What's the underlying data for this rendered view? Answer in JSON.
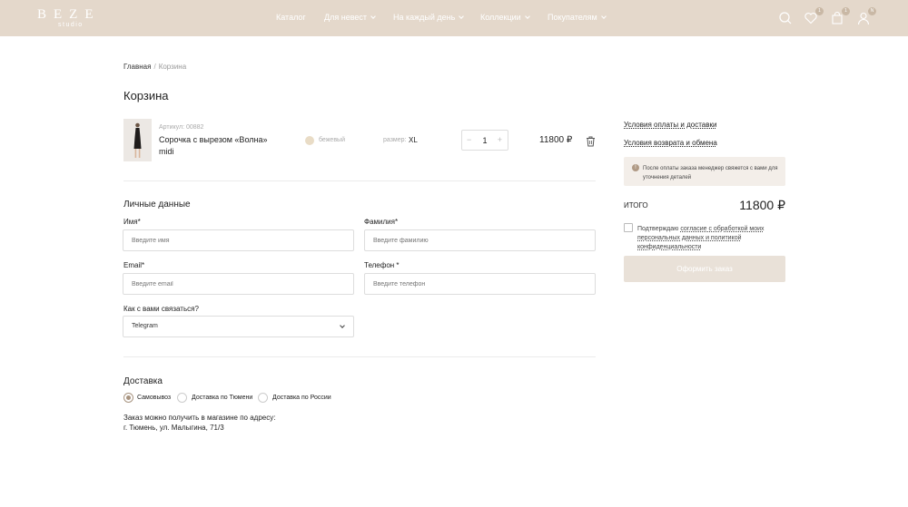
{
  "header": {
    "logo": "BEZE",
    "logo_sub": "studio",
    "nav": [
      {
        "label": "Каталог"
      },
      {
        "label": "Для невест"
      },
      {
        "label": "На каждый день"
      },
      {
        "label": "Коллекции"
      },
      {
        "label": "Покупателям"
      }
    ],
    "icons": {
      "search": "search-icon",
      "favorites": "heart-icon",
      "cart": "bag-icon",
      "account": "user-icon"
    },
    "badges": {
      "favorites": "1",
      "cart": "1",
      "account": "N"
    },
    "background": "#e4d8cb"
  },
  "breadcrumb": {
    "home": "Главная",
    "separator": "/",
    "current": "Корзина"
  },
  "page_title": "Корзина",
  "cart_item": {
    "sku": "Артикул: 00882",
    "name": "Сорочка с вырезом «Волна» midi",
    "color_label": "бежевый",
    "color_hex": "#e9dcc6",
    "size_label": "размер:",
    "size_value": "XL",
    "quantity": "1",
    "qty_minus": "−",
    "qty_plus": "+",
    "price": "11800 ₽"
  },
  "personal": {
    "title": "Личные данные",
    "first_name": {
      "label": "Имя*",
      "placeholder": "Введите имя"
    },
    "last_name": {
      "label": "Фамилия*",
      "placeholder": "Введите фамилию"
    },
    "email": {
      "label": "Email*",
      "placeholder": "Введите email"
    },
    "phone": {
      "label": "Телефон *",
      "placeholder": "Введите телефон"
    },
    "contact": {
      "label": "Как с вами связаться?",
      "value": "Telegram"
    }
  },
  "delivery": {
    "title": "Доставка",
    "options": [
      {
        "label": "Самовывоз",
        "checked": true
      },
      {
        "label": "Доставка по Тюмени",
        "checked": false
      },
      {
        "label": "Доставка по России",
        "checked": false
      }
    ],
    "pickup_line1": "Заказ можно получить в магазине по адресу:",
    "pickup_line2": "г. Тюмень, ул. Малыгина, 71/3"
  },
  "sidebar": {
    "link_payment": "Условия оплаты и доставки",
    "link_return": "Условия возврата и обмена",
    "notice": "После оплаты заказа менеджер свяжется с вами для уточнения деталей",
    "total_label": "ИТОГО",
    "total_value": "11800 ₽",
    "consent_prefix": "Подтверждаю ",
    "consent_link": "согласие с обработкой моих персональных данных и политикой конфиденциальности",
    "submit": "Оформить заказ"
  }
}
